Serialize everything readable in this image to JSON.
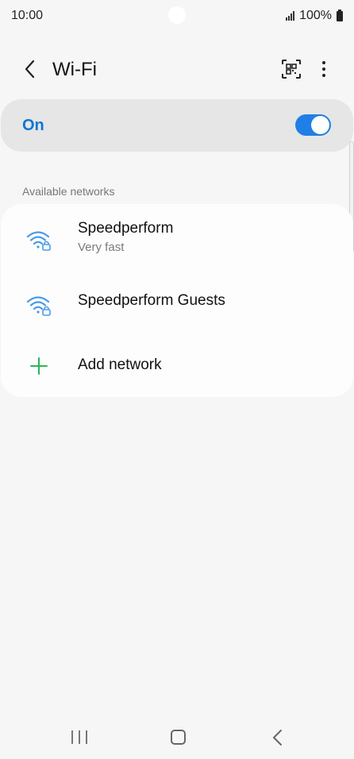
{
  "status_bar": {
    "time": "10:00",
    "battery": "100%",
    "signal_icon": "signal-bars-icon",
    "battery_icon": "battery-icon"
  },
  "header": {
    "title": "Wi-Fi",
    "back_icon": "chevron-left-icon",
    "qr_icon": "qr-code-scanner-icon",
    "more_icon": "more-vertical-icon"
  },
  "wifi_toggle": {
    "label": "On",
    "state": true,
    "accent_color": "#0b77d5"
  },
  "available_networks": {
    "header": "Available networks",
    "networks": [
      {
        "name": "Speedperform",
        "subtitle": "Very fast",
        "icon": "wifi-lock-icon"
      },
      {
        "name": "Speedperform Guests",
        "subtitle": "",
        "icon": "wifi-lock-icon"
      }
    ],
    "add_network": {
      "label": "Add network",
      "icon": "plus-icon"
    }
  },
  "nav_bar": {
    "recent_icon": "recent-apps-icon",
    "home_icon": "home-icon",
    "back_icon": "back-icon"
  }
}
